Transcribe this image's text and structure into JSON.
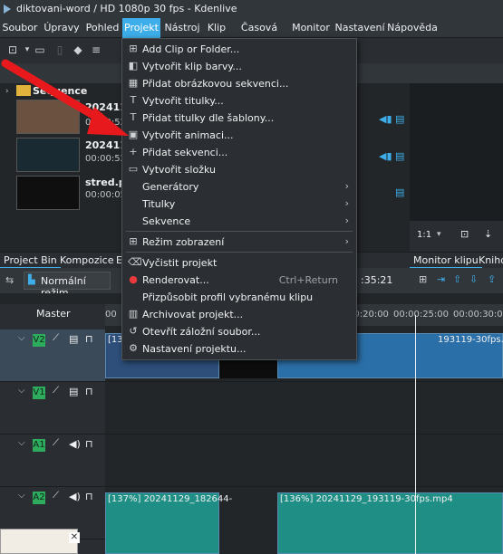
{
  "window": {
    "title": "diktovani-word / HD 1080p 30 fps - Kdenlive"
  },
  "menubar": {
    "items": [
      {
        "label": "Soubor"
      },
      {
        "label": "Úpravy"
      },
      {
        "label": "Pohled"
      },
      {
        "label": "Projekt"
      },
      {
        "label": "Nástroj"
      },
      {
        "label": "Klip"
      },
      {
        "label": "Časová osa"
      },
      {
        "label": "Monitor"
      },
      {
        "label": "Nastavení"
      },
      {
        "label": "Nápověda"
      }
    ]
  },
  "bin": {
    "folder_label": "Sequence",
    "clips": [
      {
        "name": "2024112",
        "duration": "00:00:52"
      },
      {
        "name": "2024112",
        "duration": "00:00:52:"
      },
      {
        "name": "stred.pn",
        "duration": "00:00:05"
      }
    ]
  },
  "monitor": {
    "zoom": "1:1"
  },
  "tabs": {
    "left": [
      {
        "label": "Project Bin"
      },
      {
        "label": "Kompozice"
      },
      {
        "label": "E"
      }
    ],
    "right": [
      {
        "label": "Monitor klipu"
      },
      {
        "label": "Knihov"
      }
    ]
  },
  "timeline": {
    "mode_label": "Normální režim",
    "timecode": ":35:21",
    "master_label": "Master",
    "ruler": [
      "00",
      "00:20:00",
      "00:00:25:00",
      "00:00:30:00"
    ],
    "tracks": [
      {
        "name": "V2"
      },
      {
        "name": "V1"
      },
      {
        "name": "A1"
      },
      {
        "name": "A2"
      }
    ],
    "video_clips": [
      {
        "label": "[13"
      },
      {
        "label": "193119-30fps.mp4"
      }
    ],
    "audio_clips": [
      {
        "label": "[137%] 20241129_182644-"
      },
      {
        "label": "[136%] 20241129_193119-30fps.mp4"
      }
    ]
  },
  "project_menu": {
    "items": [
      {
        "label": "Add Clip or Folder...",
        "icon": "add-clip-icon"
      },
      {
        "label": "Vytvořit klip barvy...",
        "icon": "color-clip-icon"
      },
      {
        "label": "Přidat obrázkovou sekvenci...",
        "icon": "image-sequence-icon"
      },
      {
        "label": "Vytvořit titulky...",
        "icon": "title-icon"
      },
      {
        "label": "Přidat titulky dle šablony...",
        "icon": "template-title-icon"
      },
      {
        "label": "Vytvořit animaci...",
        "icon": "animation-icon"
      },
      {
        "label": "Přidat sekvenci...",
        "icon": "plus-icon"
      },
      {
        "label": "Vytvořit složku",
        "icon": "folder-icon"
      },
      {
        "label": "Generátory",
        "submenu": true
      },
      {
        "label": "Titulky",
        "submenu": true
      },
      {
        "label": "Sekvence",
        "submenu": true
      },
      {
        "label": "Režim zobrazení",
        "icon": "view-mode-icon",
        "submenu": true
      },
      {
        "label": "Vyčistit projekt",
        "icon": "clean-icon"
      },
      {
        "label": "Renderovat...",
        "shortcut": "Ctrl+Return",
        "icon": "render-icon"
      },
      {
        "label": "Přizpůsobit profil vybranému klipu"
      },
      {
        "label": "Archivovat projekt...",
        "icon": "archive-icon"
      },
      {
        "label": "Otevřít záložní soubor...",
        "icon": "backup-icon"
      },
      {
        "label": "Nastavení projektu...",
        "icon": "settings-icon"
      }
    ]
  },
  "colors": {
    "accent": "#3daee9",
    "arrow": "#e8191c",
    "track_label": "#2eac5d"
  }
}
